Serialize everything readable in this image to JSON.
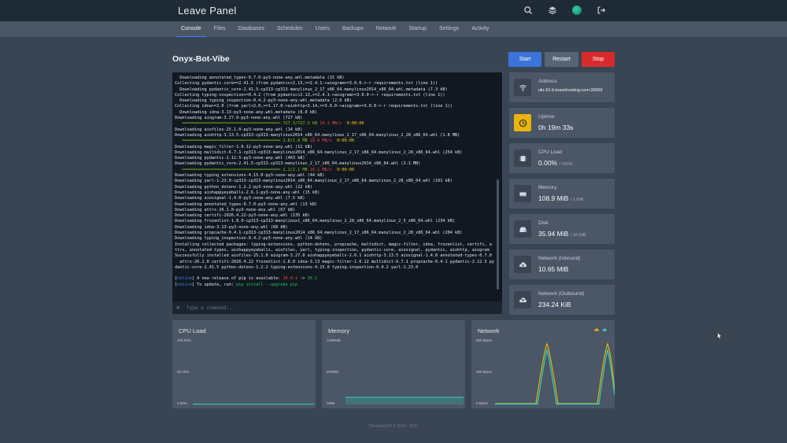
{
  "app": {
    "brand": "Leave Panel"
  },
  "top_icons": [
    "search-icon",
    "layers-icon",
    "avatar",
    "logout-icon"
  ],
  "tabs": [
    "Console",
    "Files",
    "Databases",
    "Schedules",
    "Users",
    "Backups",
    "Network",
    "Startup",
    "Settings",
    "Activity"
  ],
  "server": {
    "name": "Onyx-Bot-Vibe"
  },
  "power": {
    "start": "Start",
    "restart": "Restart",
    "stop": "Stop"
  },
  "console": {
    "lines": [
      "  Downloading annotated_types-0.7.0-py3-none-any.whl.metadata (15 kB)",
      "Collecting pydantic-core==2.41.5 (from pydantic<2.13,>=2.4.1->aiogram>=3.0.0->-r requirements.txt (line 1))",
      "  Downloading pydantic_core-2.41.5-cp313-cp313-manylinux_2_17_x86_64.manylinux2014_x86_64.whl.metadata (7.3 kB)",
      "Collecting typing-inspection>=0.4.2 (from pydantic<2.13,>=2.4.1->aiogram>=3.0.0->-r requirements.txt (line 1))",
      "  Downloading typing_inspection-0.4.2-py3-none-any.whl.metadata (2.6 kB)",
      "Collecting idna>=2.0 (from yarl<2.0,>=1.17.0->aiohttp<3.14,>=3.9.0->aiogram>=3.0.0->-r requirements.txt (line 1))",
      "  Downloading idna-3.13-py3-none-any.whl.metadata (8.0 kB)",
      "Downloading aiogram-3.27.0-py3-none-any.whl (727 kB)",
      "PB1",
      "Downloading aiofiles-25.1.0-py3-none-any.whl (14 kB)",
      "Downloading aiohttp-3.13.5-cp313-cp313-manylinux2014_x86_64.manylinux_2_17_x86_64.manylinux_2_28_x86_64.whl (1.8 MB)",
      "PB2",
      "Downloading magic_filter-1.0.12-py3-none-any.whl (11 kB)",
      "Downloading multidict-6.7.1-cp313-cp313-manylinux2014_x86_64.manylinux_2_17_x86_64.manylinux_2_28_x86_64.whl (254 kB)",
      "Downloading pydantic-2.12.5-py3-none-any.whl (463 kB)",
      "Downloading pydantic_core-2.41.5-cp313-cp313-manylinux_2_17_x86_64.manylinux2014_x86_64.whl (2.1 MB)",
      "PB3",
      "Downloading typing_extensions-4.15.0-py3-none-any.whl (44 kB)",
      "Downloading yarl-1.23.0-cp313-cp313-manylinux2014_x86_64.manylinux_2_17_x86_64.manylinux_2_28_x86_64.whl (101 kB)",
      "Downloading python_dotenv-1.2.2-py3-none-any.whl (22 kB)",
      "Downloading aiohappyeyeballs-2.6.1-py3-none-any.whl (15 kB)",
      "Downloading aiosignal-1.4.0-py3-none-any.whl (7.5 kB)",
      "Downloading annotated_types-0.7.0-py3-none-any.whl (13 kB)",
      "Downloading attrs-26.1.0-py3-none-any.whl (67 kB)",
      "Downloading certifi-2026.4.22-py3-none-any.whl (135 kB)",
      "Downloading frozenlist-1.8.0-cp313-cp313-manylinux1_x86_64.manylinux_2_28_x86_64.manylinux_2_5_x86_64.whl (234 kB)",
      "Downloading idna-3.13-py3-none-any.whl (68 kB)",
      "Downloading propcache-0.4.1-cp313-cp313-manylinux2014_x86_64.manylinux_2_17_x86_64.manylinux_2_28_x86_64.whl (204 kB)",
      "Downloading typing_inspection-0.4.2-py3-none-any.whl (14 kB)",
      "Installing collected packages: typing-extensions, python-dotenv, propcache, multidict, magic-filter, idna, frozenlist, certifi, a",
      "ttrs, annotated-types, aiohappyeyeballs, aiofiles, yarl, typing-inspection, pydantic-core, aiosignal, pydantic, aiohttp, aiogram",
      "Successfully installed aiofiles-25.1.0 aiogram-3.27.0 aiohappyeyeballs-2.6.1 aiohttp-3.13.5 aiosignal-1.4.0 annotated-types-0.7.0",
      "  attrs-26.1.0 certifi-2026.4.22 frozenlist-1.8.0 idna-3.13 magic-filter-1.0.12 multidict-6.7.1 propcache-0.4.1 pydantic-2.12.5 py",
      "dantic-core-2.41.5 python-dotenv-1.2.2 typing-extensions-4.15.0 typing-inspection-0.4.2 yarl-1.23.0",
      "",
      "NOTICE1",
      "NOTICE2"
    ],
    "progress_bars": [
      {
        "bar": "━━━━━━━━━━━━━━━━━━━━━━━━━━━━━━━━━━━━━━━━",
        "amount": "727.3/727.3 kB",
        "speed": "14.3 MB/s",
        "eta": "0:00:00"
      },
      {
        "bar": "━━━━━━━━━━━━━━━━━━━━━━━━━━━━━━━━━━━━━━━━",
        "amount": "1.8/1.8 MB",
        "speed": "18.6 MB/s",
        "eta": "0:00:00"
      },
      {
        "bar": "━━━━━━━━━━━━━━━━━━━━━━━━━━━━━━━━━━━━━━━━",
        "amount": "2.1/2.1 MB",
        "speed": "16.1 MB/s",
        "eta": "0:00:00"
      }
    ],
    "notice1": {
      "tag": "notice",
      "text": " A new release of pip is available: ",
      "old": "26.0.1",
      "arrow": " -> ",
      "new": "26.1"
    },
    "notice2": {
      "tag": "notice",
      "text": " To update, run: ",
      "cmd": "pip install --upgrade pip"
    },
    "prompt_symbol": "»",
    "input_placeholder": "Type a command..."
  },
  "stats": [
    {
      "label": "Address",
      "value": "ukr-01-b.leavehosting.com:20002",
      "unit": "",
      "icon": "wifi-icon"
    },
    {
      "label": "Uptime",
      "value": "0h 19m 33s",
      "unit": "",
      "icon": "clock-icon",
      "accent": "#eab308"
    },
    {
      "label": "CPU Load",
      "value": "0.00%",
      "unit": "/ 100%",
      "icon": "cpu-icon"
    },
    {
      "label": "Memory",
      "value": "108.9 MiB",
      "unit": "/ 1 GiB",
      "icon": "memory-icon"
    },
    {
      "label": "Disk",
      "value": "35.94 MiB",
      "unit": "/ 10 GiB",
      "icon": "disk-icon"
    },
    {
      "label": "Network (Inbound)",
      "value": "10.65 MiB",
      "unit": "",
      "icon": "cloud-download-icon"
    },
    {
      "label": "Network (Outbound)",
      "value": "234.24 KiB",
      "unit": "",
      "icon": "cloud-upload-icon"
    }
  ],
  "graphs": {
    "cpu": {
      "title": "CPU Load",
      "ticks": [
        "100.00%",
        "50.00%",
        "0.00%"
      ]
    },
    "memory": {
      "title": "Memory",
      "ticks": [
        "1200MiB",
        "600MiB",
        "0MiB"
      ]
    },
    "network": {
      "title": "Network",
      "ticks": [
        "600 Bytes",
        "300 Bytes",
        "0 Bytes"
      ],
      "legend_icons": [
        "upload-legend-icon",
        "download-legend-icon"
      ]
    }
  },
  "colors": {
    "accent": "#3b82f6",
    "start": "#3b74d9",
    "stop": "#d62b2b",
    "inbound": "#eab308",
    "outbound": "#2dd4bf"
  },
  "footer": "Pterodactyl® © 2015 - 2026"
}
